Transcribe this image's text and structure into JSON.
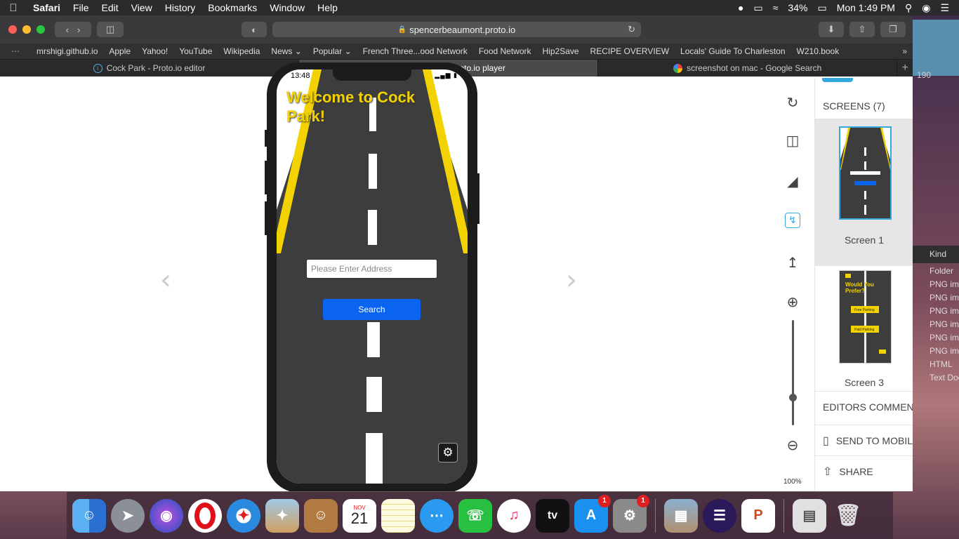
{
  "menubar": {
    "app": "Safari",
    "items": [
      "File",
      "Edit",
      "View",
      "History",
      "Bookmarks",
      "Window",
      "Help"
    ],
    "battery": "34%",
    "clock": "Mon 1:49 PM"
  },
  "browser": {
    "url": "spencerbeaumont.proto.io",
    "favorites": [
      "mrshigi.github.io",
      "Apple",
      "Yahoo!",
      "YouTube",
      "Wikipedia",
      "News",
      "Popular",
      "French Three...ood Network",
      "Food Network",
      "Hip2Save",
      "RECIPE OVERVIEW",
      "Locals' Guide To Charleston",
      "W210.book"
    ],
    "tabs": [
      {
        "title": "Cock Park - Proto.io editor",
        "icon": "protoio-icon",
        "active": false
      },
      {
        "title": "Cock Park - Proto.io player",
        "icon": "protoio-icon",
        "active": true
      },
      {
        "title": "screenshot on mac - Google Search",
        "icon": "google-icon",
        "active": false
      }
    ]
  },
  "phone": {
    "time": "13:48",
    "welcome": "Welcome to Cock Park!",
    "address_placeholder": "Please Enter Address",
    "search_label": "Search"
  },
  "player": {
    "zoom_label": "100%",
    "zoom_level_fraction": 0.35
  },
  "panel": {
    "screens_header": "SCREENS (7)",
    "screens": [
      {
        "label": "Screen 1",
        "selected": true
      },
      {
        "label": "Screen 3",
        "selected": false
      }
    ],
    "thumb_text": {
      "screen1_title": "Welcome to Cock Park!",
      "screen3_title": "Would You Prefer?",
      "screen3_opt1": "Free Parking",
      "screen3_opt2": "Paid Parking"
    },
    "editors_comments": "EDITORS COMMENTS",
    "send_to_mobile": "SEND TO MOBILE",
    "share": "SHARE"
  },
  "finder": {
    "count_fragment": "190",
    "kind_header": "Kind",
    "kinds": [
      "Folder",
      "PNG image",
      "PNG image",
      "PNG image",
      "PNG image",
      "PNG image",
      "PNG image",
      "HTML",
      "Text Document"
    ]
  },
  "dock": {
    "calendar_month": "NOV",
    "calendar_day": "21",
    "appstore_badge": "1",
    "prefs_badge": "1",
    "appletv_label": "tv"
  },
  "colors": {
    "road": "#3d3d3d",
    "road_edge_yellow": "#f2d200",
    "search_button": "#0a64f0",
    "selection_border": "#35a8e0"
  }
}
